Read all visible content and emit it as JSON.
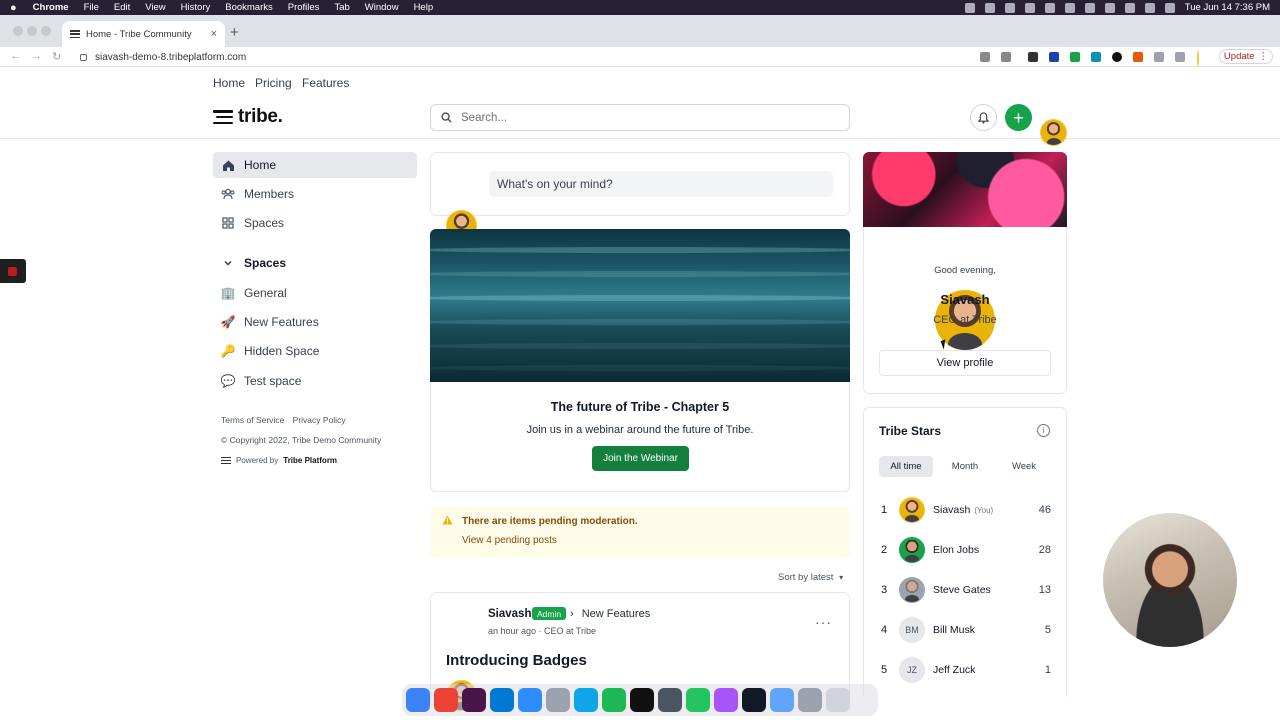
{
  "menubar": {
    "apple": "",
    "items": [
      "Chrome",
      "File",
      "Edit",
      "View",
      "History",
      "Bookmarks",
      "Profiles",
      "Tab",
      "Window",
      "Help"
    ],
    "clock": "Tue Jun 14  7:36 PM"
  },
  "browser": {
    "tab_title": "Home - Tribe Community",
    "tab_close": "×",
    "new_tab": "+",
    "url": "siavash-demo-8.tribeplatform.com",
    "update_label": "Update"
  },
  "topnav": {
    "home": "Home",
    "pricing": "Pricing",
    "features": "Features"
  },
  "header": {
    "logo_text": "tribe.",
    "search_placeholder": "Search...",
    "add_label": "+"
  },
  "sidebar": {
    "items": [
      {
        "label": "Home",
        "icon": "home-icon"
      },
      {
        "label": "Members",
        "icon": "members-icon"
      },
      {
        "label": "Spaces",
        "icon": "spaces-icon"
      }
    ],
    "spaces_header": "Spaces",
    "spaces": [
      {
        "label": "General",
        "icon": "🏢"
      },
      {
        "label": "New Features",
        "icon": "🚀"
      },
      {
        "label": "Hidden Space",
        "icon": "🔑"
      },
      {
        "label": "Test space",
        "icon": "💬"
      }
    ],
    "terms": "Terms of Service",
    "privacy": "Privacy Policy",
    "copyright": "© Copyright 2022, Tribe Demo Community",
    "powered_prefix": "Powered by",
    "powered_brand": "Tribe Platform"
  },
  "composer": {
    "prompt": "What's on your mind?"
  },
  "webinar": {
    "title": "The future of Tribe - Chapter 5",
    "subtitle": "Join us in a webinar around the future of Tribe.",
    "button": "Join the Webinar"
  },
  "moderation": {
    "title": "There are items pending moderation.",
    "link": "View 4 pending posts"
  },
  "sort": {
    "label": "Sort by latest"
  },
  "post": {
    "author": "Siavash",
    "badge": "Admin",
    "separator": "›",
    "space": "New Features",
    "meta": "an hour ago · CEO at Tribe",
    "more": "···",
    "title": "Introducing Badges"
  },
  "profile": {
    "greeting": "Good evening,",
    "name": "Siavash",
    "title": "CEO at Tribe",
    "button": "View profile"
  },
  "stars": {
    "title": "Tribe Stars",
    "info": "i",
    "tabs": [
      "All time",
      "Month",
      "Week"
    ],
    "active_tab": "All time",
    "rows": [
      {
        "rank": "1",
        "name": "Siavash",
        "you": "(You)",
        "score": "46",
        "initials": ""
      },
      {
        "rank": "2",
        "name": "Elon Jobs",
        "you": "",
        "score": "28",
        "initials": ""
      },
      {
        "rank": "3",
        "name": "Steve Gates",
        "you": "",
        "score": "13",
        "initials": ""
      },
      {
        "rank": "4",
        "name": "Bill Musk",
        "you": "",
        "score": "5",
        "initials": "BM"
      },
      {
        "rank": "5",
        "name": "Jeff Zuck",
        "you": "",
        "score": "1",
        "initials": "JZ"
      }
    ]
  },
  "colors": {
    "brand_green": "#16a34a",
    "moderation_bg": "#fefce8",
    "moderation_text": "#854d0e"
  },
  "dock": {
    "apps": [
      "finder-icon",
      "chrome-icon",
      "slack-icon",
      "vscode-icon",
      "zoom-icon",
      "app-icon",
      "app-icon",
      "spotify-icon",
      "notion-icon",
      "activity-icon",
      "messages-icon",
      "figma-icon",
      "terminal-icon",
      "folder-icon",
      "app-icon",
      "trash-icon"
    ],
    "colors": [
      "#3b82f6",
      "#ea4335",
      "#4a154b",
      "#0078d4",
      "#2d8cff",
      "#9ca3af",
      "#0ea5e9",
      "#1db954",
      "#111111",
      "#4b5563",
      "#22c55e",
      "#a855f7",
      "#111827",
      "#60a5fa",
      "#9ca3af",
      "#d1d5db"
    ]
  }
}
